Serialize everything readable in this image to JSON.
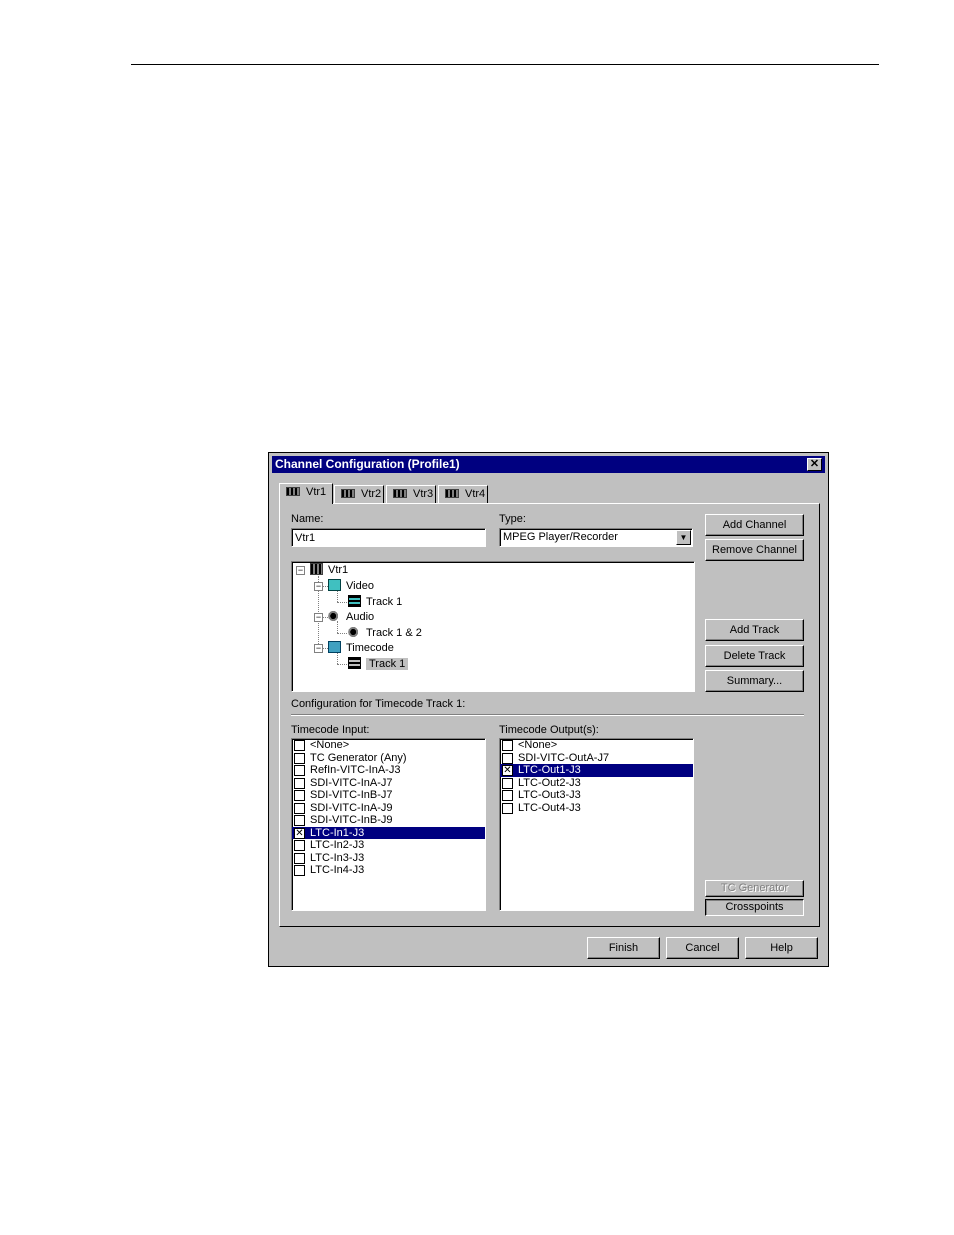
{
  "window": {
    "title": "Channel Configuration (Profile1)",
    "close_symbol": "✕"
  },
  "tabs": [
    {
      "label": "Vtr1",
      "active": true
    },
    {
      "label": "Vtr2",
      "active": false
    },
    {
      "label": "Vtr3",
      "active": false
    },
    {
      "label": "Vtr4",
      "active": false
    }
  ],
  "form": {
    "name_label": "Name:",
    "name_value": "Vtr1",
    "type_label": "Type:",
    "type_value": "MPEG Player/Recorder",
    "dropdown_arrow": "▼"
  },
  "channel_buttons": {
    "add_channel": "Add Channel",
    "remove_channel": "Remove Channel",
    "add_track": "Add Track",
    "delete_track": "Delete Track",
    "summary": "Summary..."
  },
  "tree": {
    "collapse_symbol": "−",
    "root": "Vtr1",
    "video": "Video",
    "video_track": "Track 1",
    "audio": "Audio",
    "audio_track": "Track 1 & 2",
    "timecode": "Timecode",
    "timecode_track": "Track 1"
  },
  "config_heading": "Configuration for Timecode Track 1:",
  "timecode_input": {
    "label": "Timecode Input:",
    "items": [
      {
        "label": "<None>",
        "checked": false,
        "selected": false
      },
      {
        "label": "TC Generator (Any)",
        "checked": false,
        "selected": false
      },
      {
        "label": "RefIn-VITC-InA-J3",
        "checked": false,
        "selected": false
      },
      {
        "label": "SDI-VITC-InA-J7",
        "checked": false,
        "selected": false
      },
      {
        "label": "SDI-VITC-InB-J7",
        "checked": false,
        "selected": false
      },
      {
        "label": "SDI-VITC-InA-J9",
        "checked": false,
        "selected": false
      },
      {
        "label": "SDI-VITC-InB-J9",
        "checked": false,
        "selected": false
      },
      {
        "label": "LTC-In1-J3",
        "checked": true,
        "selected": true
      },
      {
        "label": "LTC-In2-J3",
        "checked": false,
        "selected": false
      },
      {
        "label": "LTC-In3-J3",
        "checked": false,
        "selected": false
      },
      {
        "label": "LTC-In4-J3",
        "checked": false,
        "selected": false
      }
    ]
  },
  "timecode_output": {
    "label": "Timecode Output(s):",
    "items": [
      {
        "label": "<None>",
        "checked": false,
        "selected": false
      },
      {
        "label": "SDI-VITC-OutA-J7",
        "checked": false,
        "selected": false
      },
      {
        "label": "LTC-Out1-J3",
        "checked": true,
        "selected": true
      },
      {
        "label": "LTC-Out2-J3",
        "checked": false,
        "selected": false
      },
      {
        "label": "LTC-Out3-J3",
        "checked": false,
        "selected": false
      },
      {
        "label": "LTC-Out4-J3",
        "checked": false,
        "selected": false
      }
    ]
  },
  "side_buttons": {
    "tc_generator": "TC Generator",
    "crosspoints": "Crosspoints"
  },
  "footer": {
    "finish": "Finish",
    "cancel": "Cancel",
    "help": "Help"
  },
  "colors": {
    "titlebar": "#000080",
    "dialog_bg": "#c0c0c0",
    "selection": "#000080"
  }
}
